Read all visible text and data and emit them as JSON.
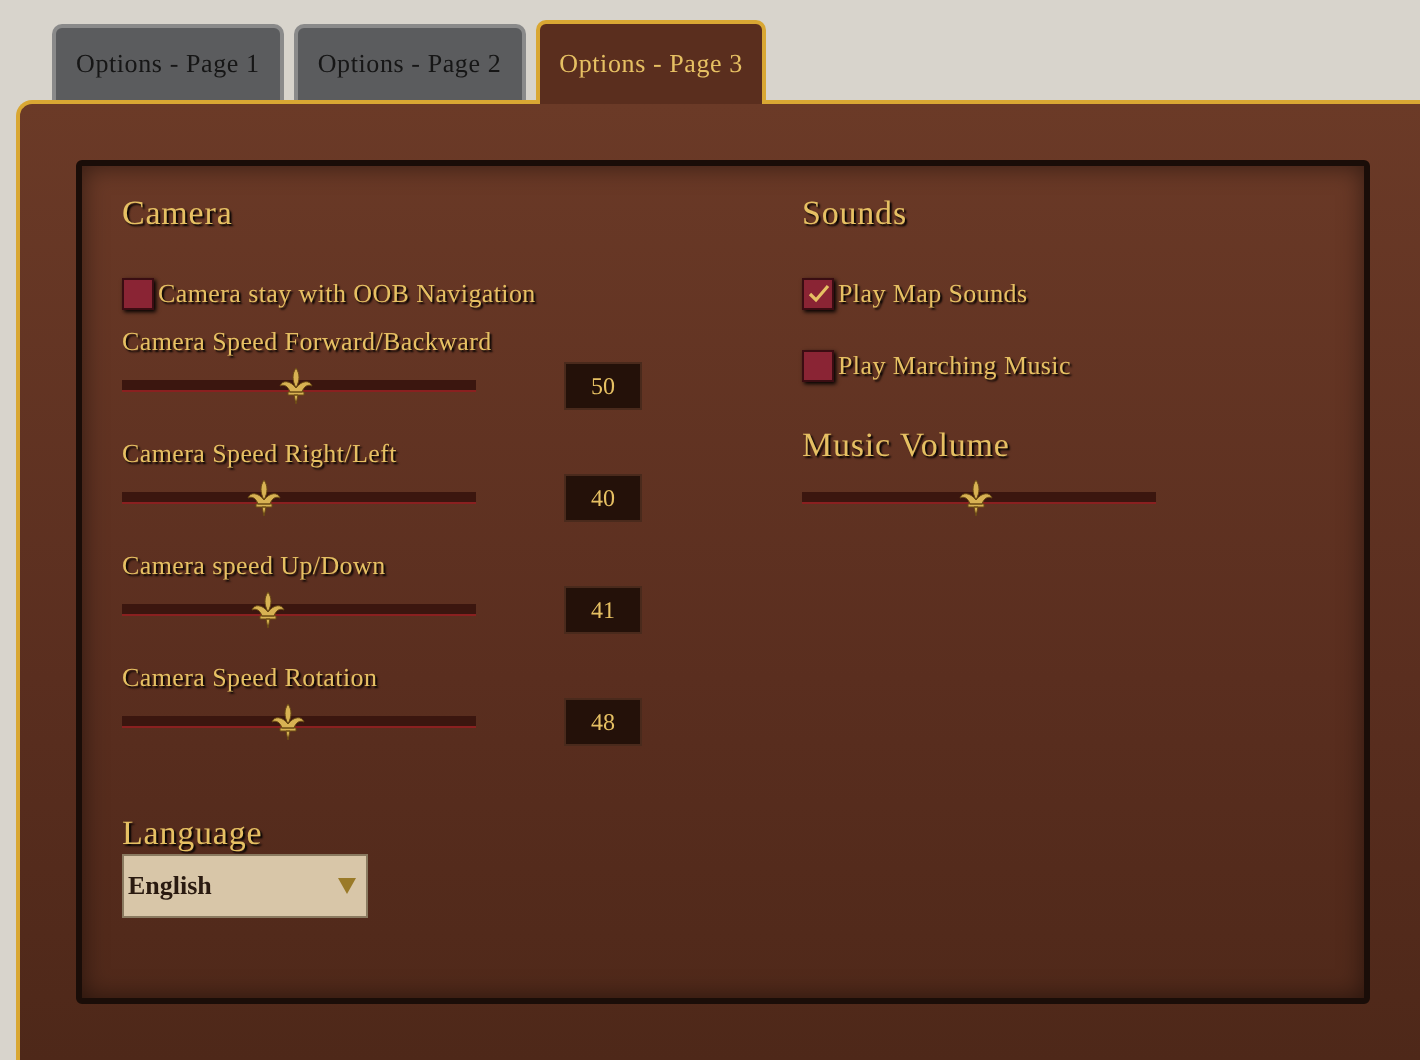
{
  "tabs": [
    {
      "label": "Options - Page 1",
      "selected": false
    },
    {
      "label": "Options - Page 2",
      "selected": false
    },
    {
      "label": "Options - Page 3",
      "selected": true
    }
  ],
  "camera": {
    "title": "Camera",
    "checkbox": {
      "label": "Camera stay with OOB Navigation",
      "checked": false
    },
    "sliders": [
      {
        "label": "Camera Speed Forward/Backward",
        "level": 0.49,
        "value": "50"
      },
      {
        "label": "Camera Speed Right/Left",
        "level": 0.4,
        "value": "40"
      },
      {
        "label": "Camera speed Up/Down",
        "level": 0.41,
        "value": "41"
      },
      {
        "label": "Camera Speed Rotation",
        "level": 0.47,
        "value": "48"
      }
    ]
  },
  "language": {
    "title": "Language",
    "value": "English"
  },
  "sounds": {
    "title": "Sounds",
    "checkboxes": [
      {
        "label": "Play Map Sounds",
        "checked": true
      },
      {
        "label": "Play Marching Music",
        "checked": false
      }
    ]
  },
  "music_volume": {
    "title": "Music Volume",
    "level": 0.49
  }
}
